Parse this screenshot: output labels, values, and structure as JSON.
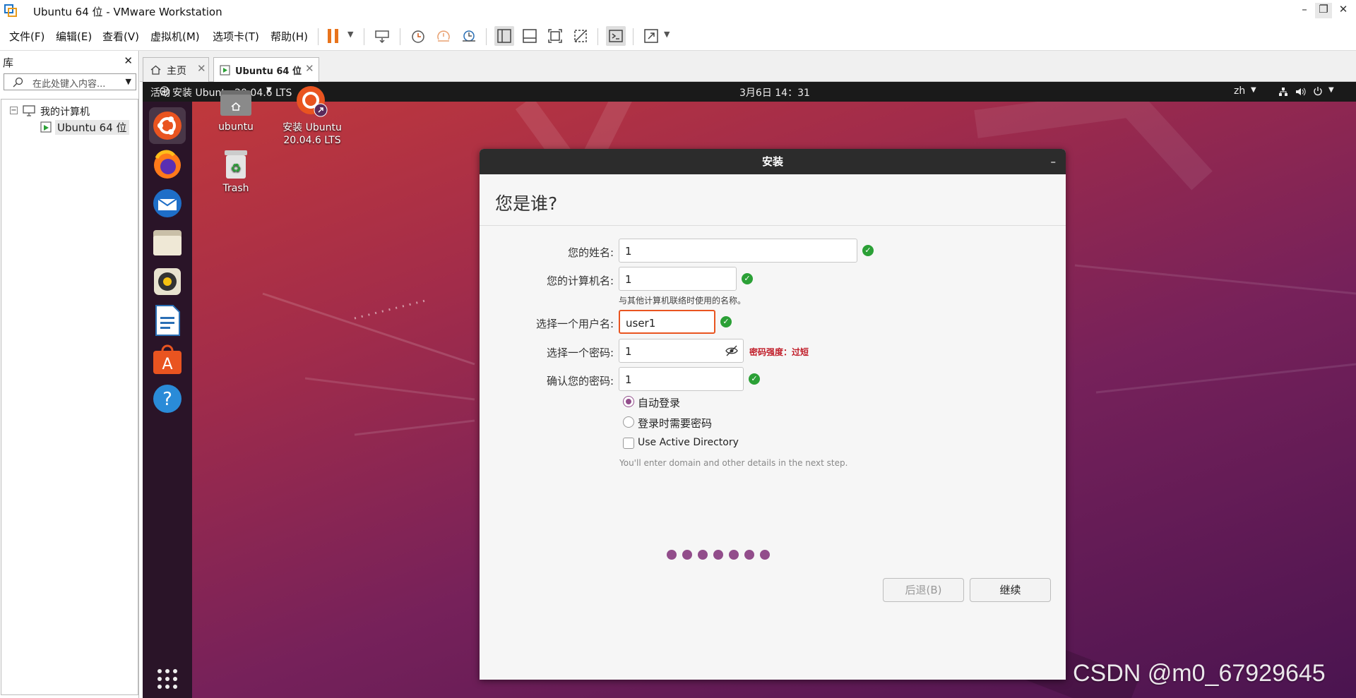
{
  "window": {
    "title": "Ubuntu 64 位 - VMware Workstation"
  },
  "menu": [
    "文件(F)",
    "编辑(E)",
    "查看(V)",
    "虚拟机(M)",
    "选项卡(T)",
    "帮助(H)"
  ],
  "library": {
    "title": "库",
    "search_placeholder": "在此处键入内容...",
    "tree_root": "我的计算机",
    "tree_child": "Ubuntu 64 位"
  },
  "tabs": [
    {
      "label": "主页"
    },
    {
      "label": "Ubuntu 64 位"
    }
  ],
  "ubuntu": {
    "activities": "活动",
    "app_menu": "安装 Ubuntu 20.04.6 LTS",
    "clock": "3月6日  14：31",
    "lang": "zh",
    "desktop_icons": [
      {
        "label": "ubuntu"
      },
      {
        "label": "安装 Ubuntu 20.04.6 LTS"
      },
      {
        "label": "Trash"
      }
    ]
  },
  "installer": {
    "window_title": "安装",
    "heading": "您是谁?",
    "name_label": "您的姓名:",
    "name_value": "1",
    "computer_label": "您的计算机名:",
    "computer_value": "1",
    "computer_hint": "与其他计算机联络时使用的名称。",
    "user_label": "选择一个用户名:",
    "user_value": "user1",
    "password_label": "选择一个密码:",
    "password_value": "1",
    "password_strength": "密码强度：过短",
    "confirm_label": "确认您的密码:",
    "confirm_value": "1",
    "auto_login": "自动登录",
    "require_password": "登录时需要密码",
    "active_directory": "Use Active Directory",
    "ad_hint": "You'll enter domain and other details in the next step.",
    "back_button": "后退(B)",
    "continue_button": "继续",
    "progress_total": 7
  },
  "watermark": "CSDN @m0_67929645",
  "colors": {
    "accent": "#e95420",
    "check": "#2ba036",
    "dots": "#924d8b",
    "strength": "#c01c28"
  }
}
